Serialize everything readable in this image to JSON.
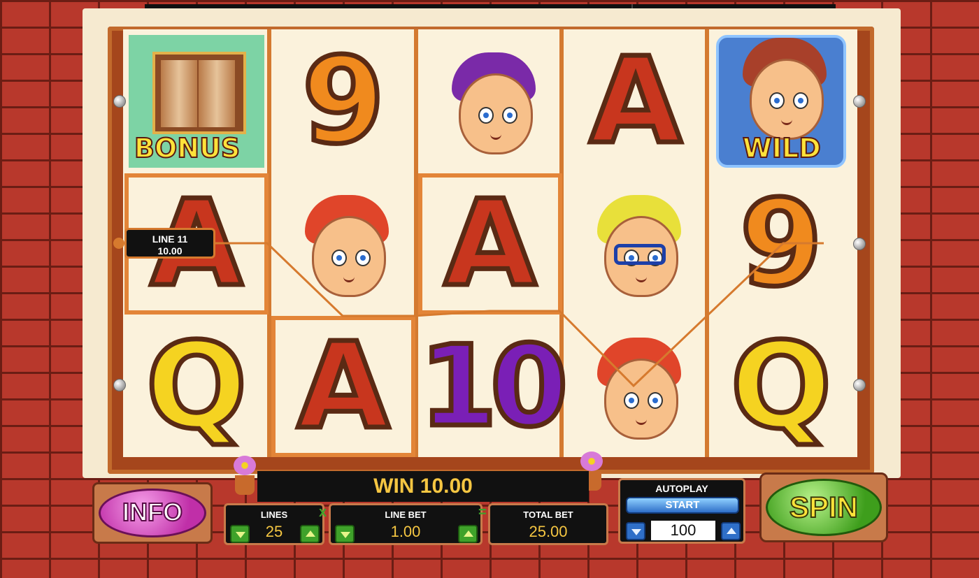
{
  "top_bar": {
    "line_pays": "LINE 11 PAYS  10.00",
    "win": "WIN  10.00"
  },
  "reels": {
    "symbols": [
      [
        "BONUS",
        "A",
        "Q"
      ],
      [
        "9",
        "Girl",
        "A"
      ],
      [
        "Girl",
        "A",
        "10"
      ],
      [
        "A",
        "Boy with glasses",
        "Girl"
      ],
      [
        "WILD",
        "9",
        "Q"
      ]
    ],
    "bonus_label": "BONUS",
    "wild_label": "WILD",
    "letters": {
      "a": "A",
      "q": "Q",
      "nine": "9",
      "ten": "10"
    }
  },
  "line_tag": {
    "line": "LINE 11",
    "amount": "10.00"
  },
  "payline_color": "#d67a2e",
  "bottom": {
    "win_text": "WIN  10.00",
    "info_label": "INFO",
    "spin_label": "SPIN",
    "lines_label": "LINES",
    "lines_value": "25",
    "line_bet_label": "LINE BET",
    "line_bet_value": "1.00",
    "total_bet_label": "TOTAL BET",
    "total_bet_value": "25.00",
    "autoplay_label": "AUTOPLAY",
    "start_label": "START",
    "autoplay_count": "100",
    "times_op": "x",
    "equals_op": "="
  },
  "colors": {
    "frame": "#f6ead0",
    "reel_border": "#d47a30",
    "win_text": "#f5c642",
    "spin_green": "#3e9e1c",
    "info_pink": "#c02fa8"
  }
}
